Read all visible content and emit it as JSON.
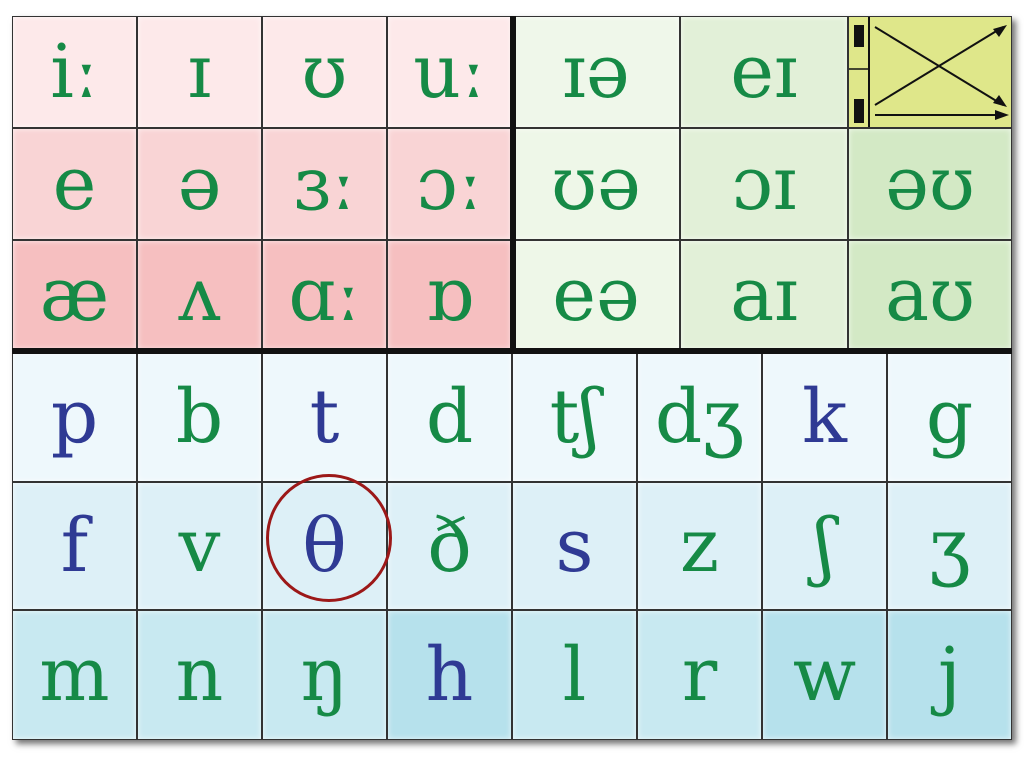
{
  "colors": {
    "voiced": "#168a46",
    "voiceless": "#2f3a94",
    "highlight_circle": "#9c1818"
  },
  "monophthongs": [
    [
      "iː",
      "ɪ",
      "ʊ",
      "uː"
    ],
    [
      "e",
      "ə",
      "ɜː",
      "ɔː"
    ],
    [
      "æ",
      "ʌ",
      "ɑː",
      "ɒ"
    ]
  ],
  "diphthongs": [
    [
      "ɪə",
      "eɪ"
    ],
    [
      "ʊə",
      "ɔɪ",
      "əʊ"
    ],
    [
      "eə",
      "aɪ",
      "aʊ"
    ]
  ],
  "consonants": [
    [
      {
        "s": "p",
        "v": false
      },
      {
        "s": "b",
        "v": true
      },
      {
        "s": "t",
        "v": false
      },
      {
        "s": "d",
        "v": true
      },
      {
        "s": "tʃ",
        "v": true
      },
      {
        "s": "dʒ",
        "v": true
      },
      {
        "s": "k",
        "v": false
      },
      {
        "s": "g",
        "v": true
      }
    ],
    [
      {
        "s": "f",
        "v": false
      },
      {
        "s": "v",
        "v": true
      },
      {
        "s": "θ",
        "v": false
      },
      {
        "s": "ð",
        "v": true
      },
      {
        "s": "s",
        "v": false
      },
      {
        "s": "z",
        "v": true
      },
      {
        "s": "ʃ",
        "v": true
      },
      {
        "s": "ʒ",
        "v": true
      }
    ],
    [
      {
        "s": "m",
        "v": true
      },
      {
        "s": "n",
        "v": true
      },
      {
        "s": "ŋ",
        "v": true
      },
      {
        "s": "h",
        "v": false
      },
      {
        "s": "l",
        "v": true
      },
      {
        "s": "r",
        "v": true
      },
      {
        "s": "w",
        "v": true
      },
      {
        "s": "j",
        "v": true
      }
    ]
  ],
  "highlighted": "θ",
  "legend_icon": "intonation-arrows-icon"
}
